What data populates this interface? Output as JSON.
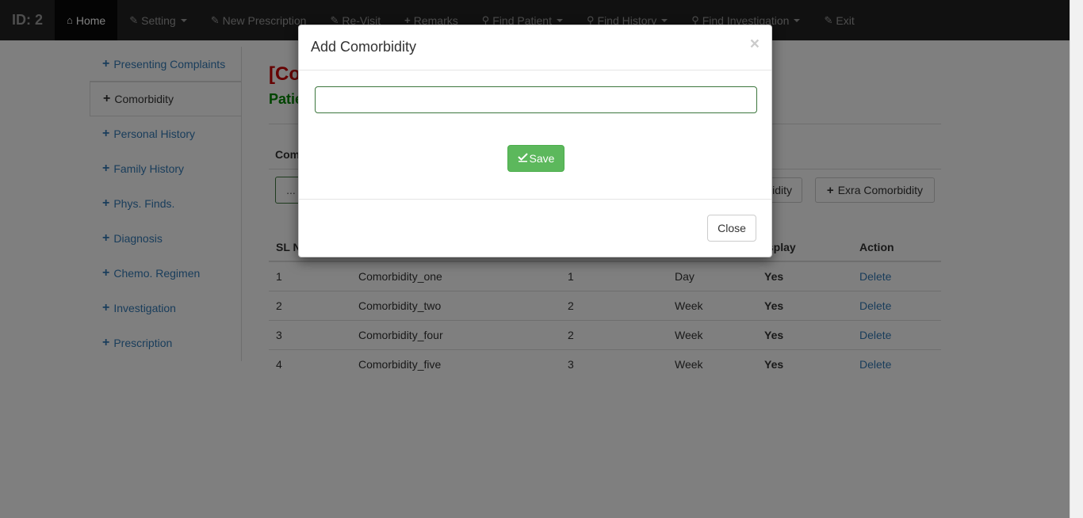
{
  "navbar": {
    "brand": "ID: 2",
    "items": [
      {
        "label": "Home",
        "icon": "home-icon",
        "active": true
      },
      {
        "label": "Setting",
        "icon": "edit-icon",
        "dropdown": true
      },
      {
        "label": "New Prescription",
        "icon": "edit-icon"
      },
      {
        "label": "Re-Visit",
        "icon": "edit-icon"
      },
      {
        "label": "Remarks",
        "icon": "plus-icon"
      },
      {
        "label": "Find Patient",
        "icon": "search-icon",
        "dropdown": true
      },
      {
        "label": "Find History",
        "icon": "search-icon",
        "dropdown": true
      },
      {
        "label": "Find Investigation",
        "icon": "search-icon",
        "dropdown": true
      },
      {
        "label": "Exit",
        "icon": "edit-icon"
      }
    ]
  },
  "sidebar": {
    "items": [
      {
        "label": "Presenting Complaints"
      },
      {
        "label": "Comorbidity"
      },
      {
        "label": "Personal History"
      },
      {
        "label": "Family History"
      },
      {
        "label": "Phys. Finds."
      },
      {
        "label": "Diagnosis"
      },
      {
        "label": "Chemo. Regimen"
      },
      {
        "label": "Investigation"
      },
      {
        "label": "Prescription"
      }
    ]
  },
  "main": {
    "title_red": "[Co",
    "title_green": "Patie",
    "section_label": "Com",
    "small_button": "...",
    "partial_button": "idity",
    "extra_button": "Exra Comorbidity",
    "table": {
      "headers": [
        "SL N",
        "",
        "",
        "",
        "isplay",
        "Action"
      ],
      "rows": [
        [
          "1",
          "Comorbidity_one",
          "1",
          "Day",
          "Yes",
          "Delete"
        ],
        [
          "2",
          "Comorbidity_two",
          "2",
          "Week",
          "Yes",
          "Delete"
        ],
        [
          "3",
          "Comorbidity_four",
          "2",
          "Week",
          "Yes",
          "Delete"
        ],
        [
          "4",
          "Comorbidity_five",
          "3",
          "Week",
          "Yes",
          "Delete"
        ]
      ]
    }
  },
  "modal": {
    "title": "Add Comorbidity",
    "close_x": "×",
    "input_value": "",
    "input_placeholder": "",
    "save_label": "Save",
    "close_label": "Close"
  }
}
